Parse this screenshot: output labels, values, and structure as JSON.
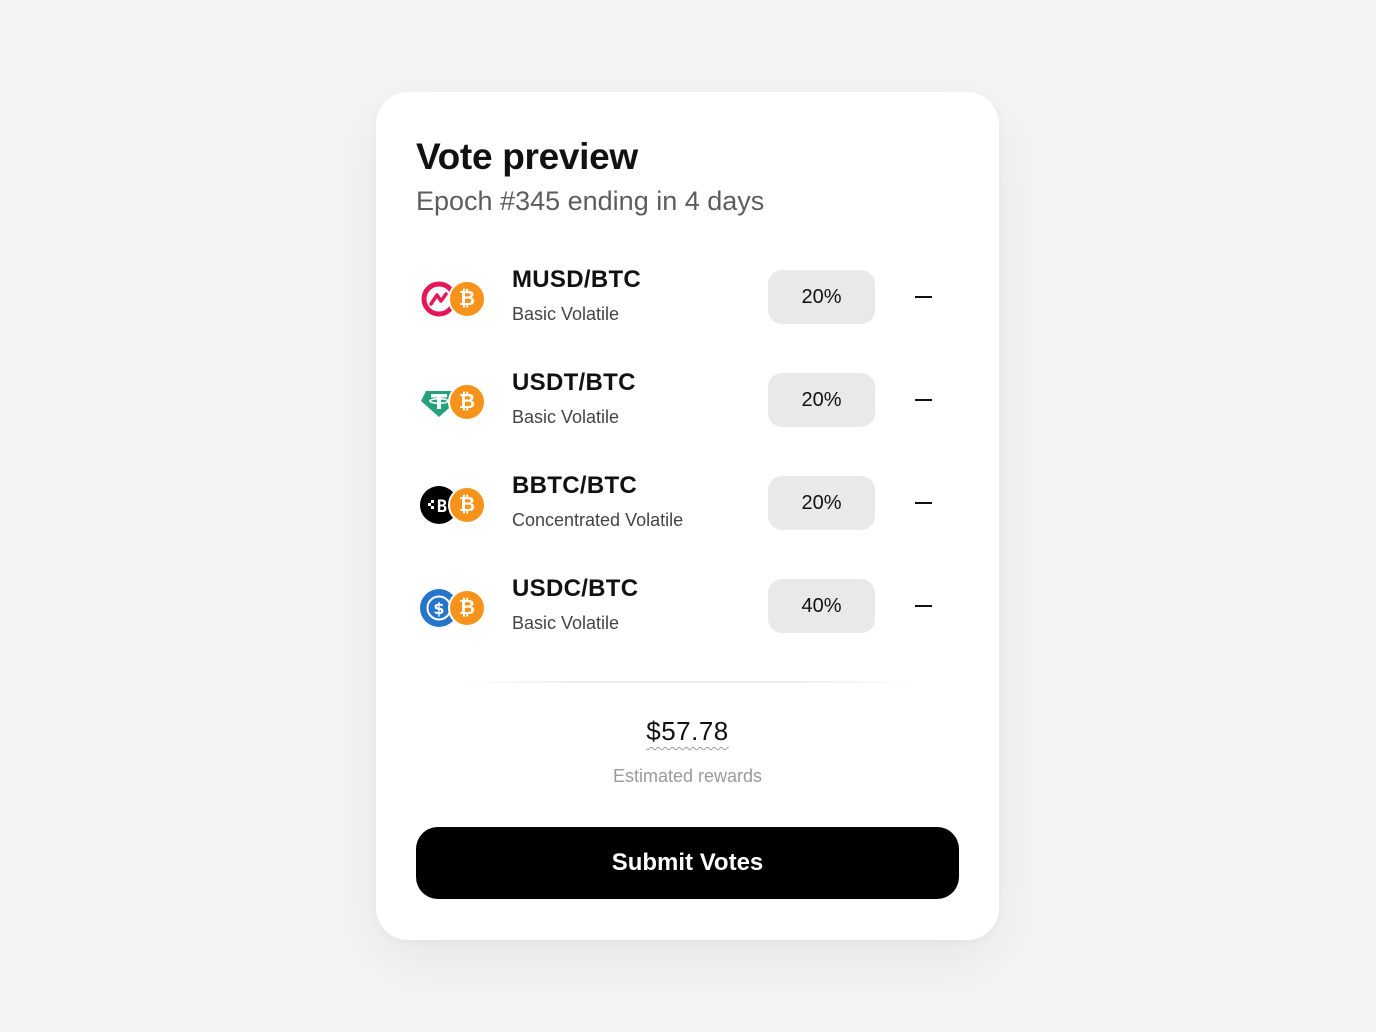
{
  "vote_preview": {
    "title": "Vote preview",
    "subtitle": "Epoch #345 ending in 4 days"
  },
  "pools": [
    {
      "name": "MUSD/BTC",
      "type": "Basic Volatile",
      "percent": "20%",
      "token_icon": "musd-icon"
    },
    {
      "name": "USDT/BTC",
      "type": "Basic Volatile",
      "percent": "20%",
      "token_icon": "usdt-icon"
    },
    {
      "name": "BBTC/BTC",
      "type": "Concentrated Volatile",
      "percent": "20%",
      "token_icon": "bbtc-icon"
    },
    {
      "name": "USDC/BTC",
      "type": "Basic Volatile",
      "percent": "40%",
      "token_icon": "usdc-icon"
    }
  ],
  "rewards": {
    "amount": "$57.78",
    "label": "Estimated rewards"
  },
  "submit_label": "Submit Votes",
  "colors": {
    "btc": "#f7931a",
    "musd": "#e5175a",
    "usdt": "#26a17b",
    "bbtc": "#000000",
    "usdc": "#2775ca",
    "button": "#000000"
  }
}
